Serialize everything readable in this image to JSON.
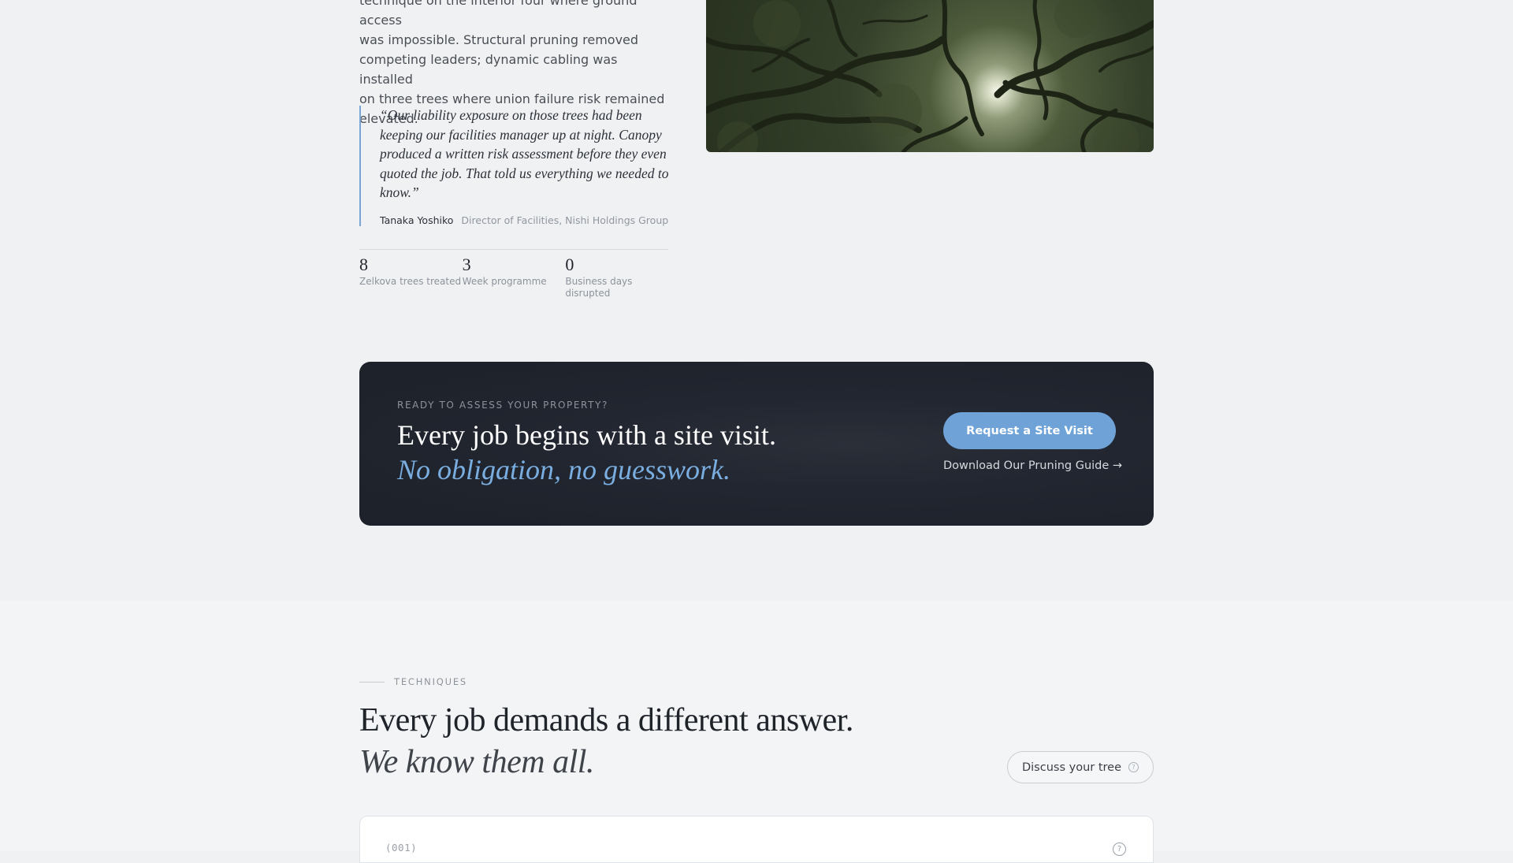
{
  "case_study": {
    "paragraph_lines": [
      "technique on the interior four where ground access",
      "was impossible. Structural pruning removed",
      "competing leaders; dynamic cabling was installed",
      "on three trees where union failure risk remained",
      "elevated."
    ],
    "quote": "“Our liability exposure on those trees had been keeping our facilities manager up at night. Canopy produced a written risk assessment before they even quoted the job. That told us everything we needed to know.”",
    "quote_name": "Tanaka Yoshiko",
    "quote_role": "Director of Facilities, Nishi Holdings Group",
    "stats": [
      {
        "value": "8",
        "label": "Zelkova trees treated"
      },
      {
        "value": "3",
        "label": "Week programme"
      },
      {
        "value": "0",
        "label": "Business days disrupted"
      }
    ]
  },
  "cta": {
    "eyebrow": "READY TO ASSESS YOUR PROPERTY?",
    "title": "Every job begins with a site visit.",
    "subtitle": "No obligation, no guesswork.",
    "button_label": "Request a Site Visit",
    "link_label": "Download Our Pruning Guide →"
  },
  "techniques": {
    "eyebrow": "TECHNIQUES",
    "title": "Every job demands a different answer.",
    "subtitle": "We know them all.",
    "discuss_label": "Discuss your tree",
    "help_glyph": "?",
    "card_number": "(001)"
  },
  "colors": {
    "accent": "#7aa6d6",
    "cta_background": "#1f232b",
    "cta_button": "#6fa3d8",
    "page_background": "#f0f1f3"
  }
}
